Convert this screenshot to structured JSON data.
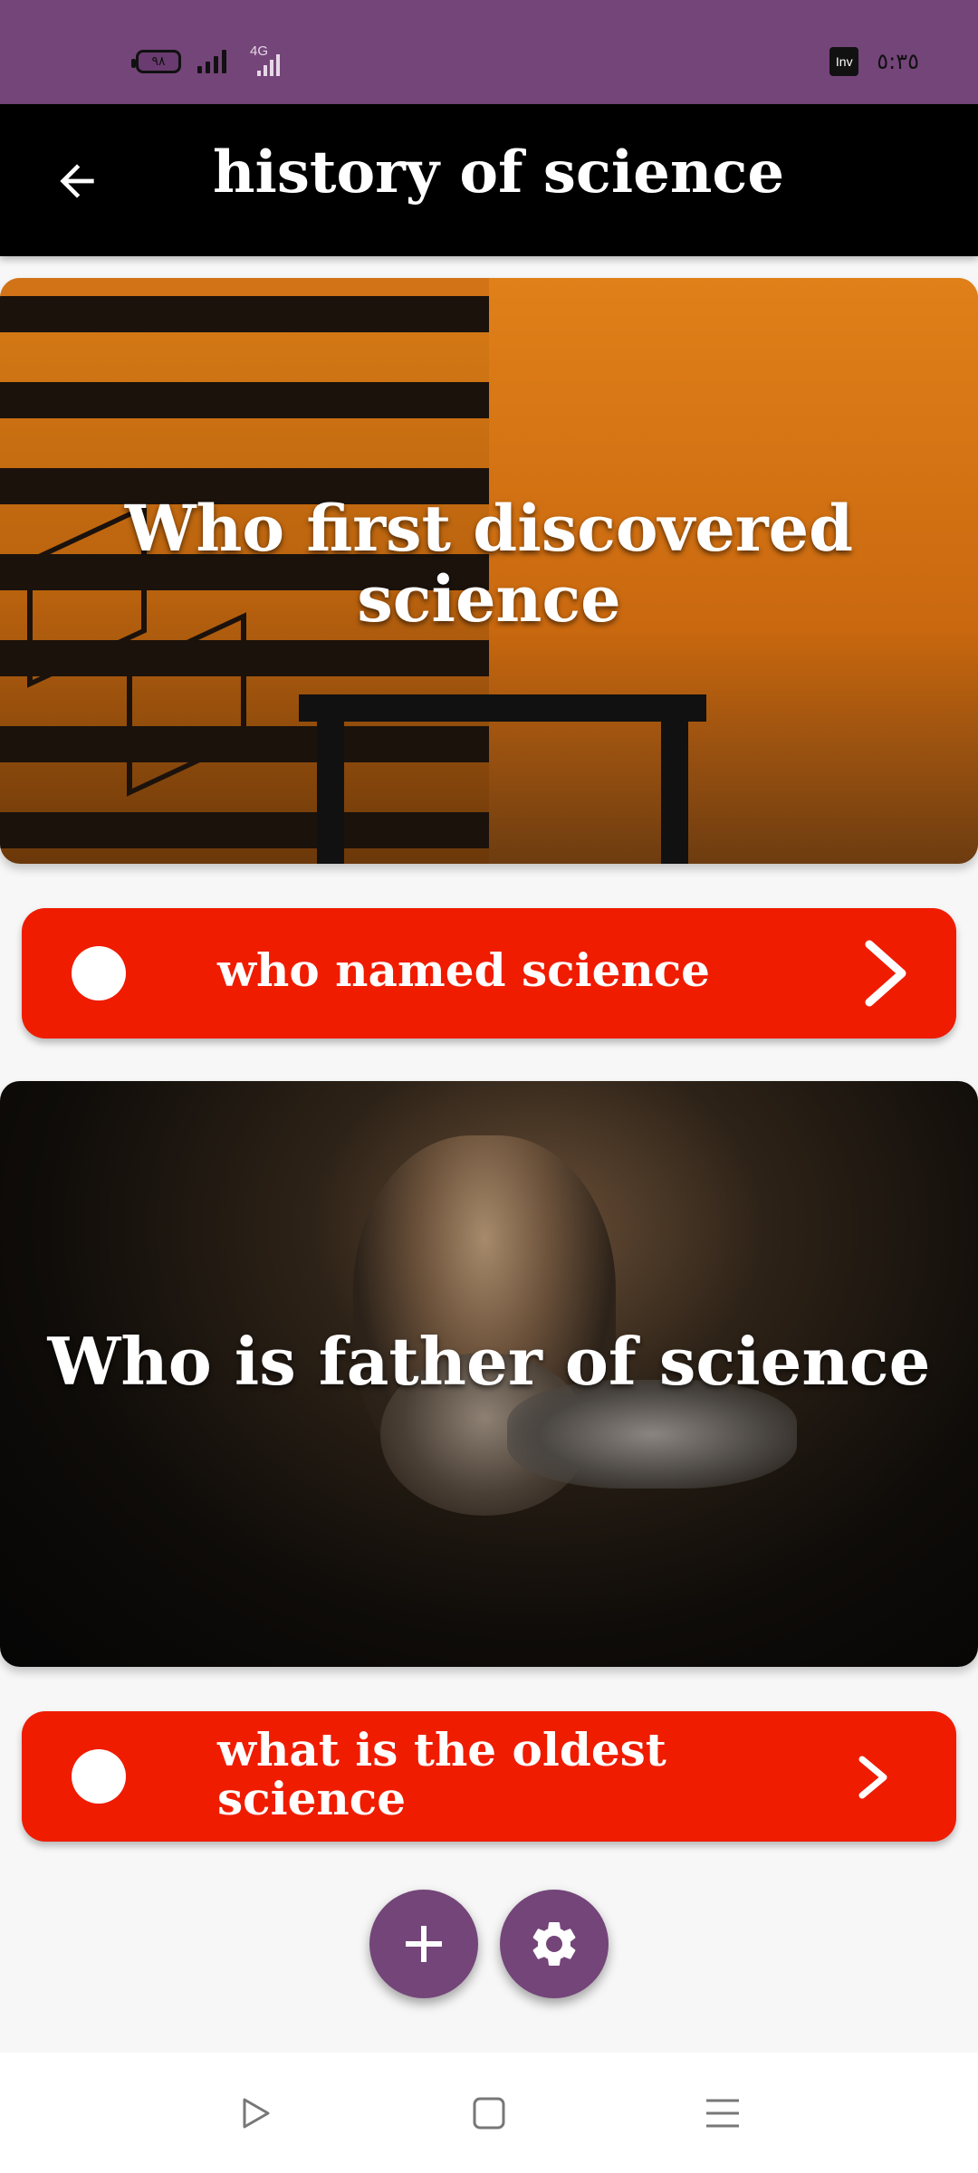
{
  "status_bar": {
    "battery": "٩٨",
    "network_type": "4G",
    "notification_icon": "Inv",
    "time": "٥:٣٥"
  },
  "app_bar": {
    "title": "history of science",
    "back_icon": "arrow-left-icon"
  },
  "cards": [
    {
      "title": "Who first discovered science",
      "image": "orange-striped-room-illusion"
    },
    {
      "title": "Who is father of science",
      "image": "bearded-scientist-portrait"
    }
  ],
  "list_buttons": [
    {
      "label": "who named science",
      "icon": "chevron-right-icon"
    },
    {
      "label": "what is the oldest science",
      "icon": "chevron-right-icon"
    }
  ],
  "fabs": [
    {
      "name": "add",
      "icon": "plus-icon"
    },
    {
      "name": "settings",
      "icon": "gear-icon"
    }
  ],
  "colors": {
    "status_bar": "#744579",
    "app_bar": "#000000",
    "accent": "#ef1c00",
    "fab": "#744579"
  },
  "nav_bar": [
    "back-triangle-icon",
    "home-square-icon",
    "menu-lines-icon"
  ]
}
